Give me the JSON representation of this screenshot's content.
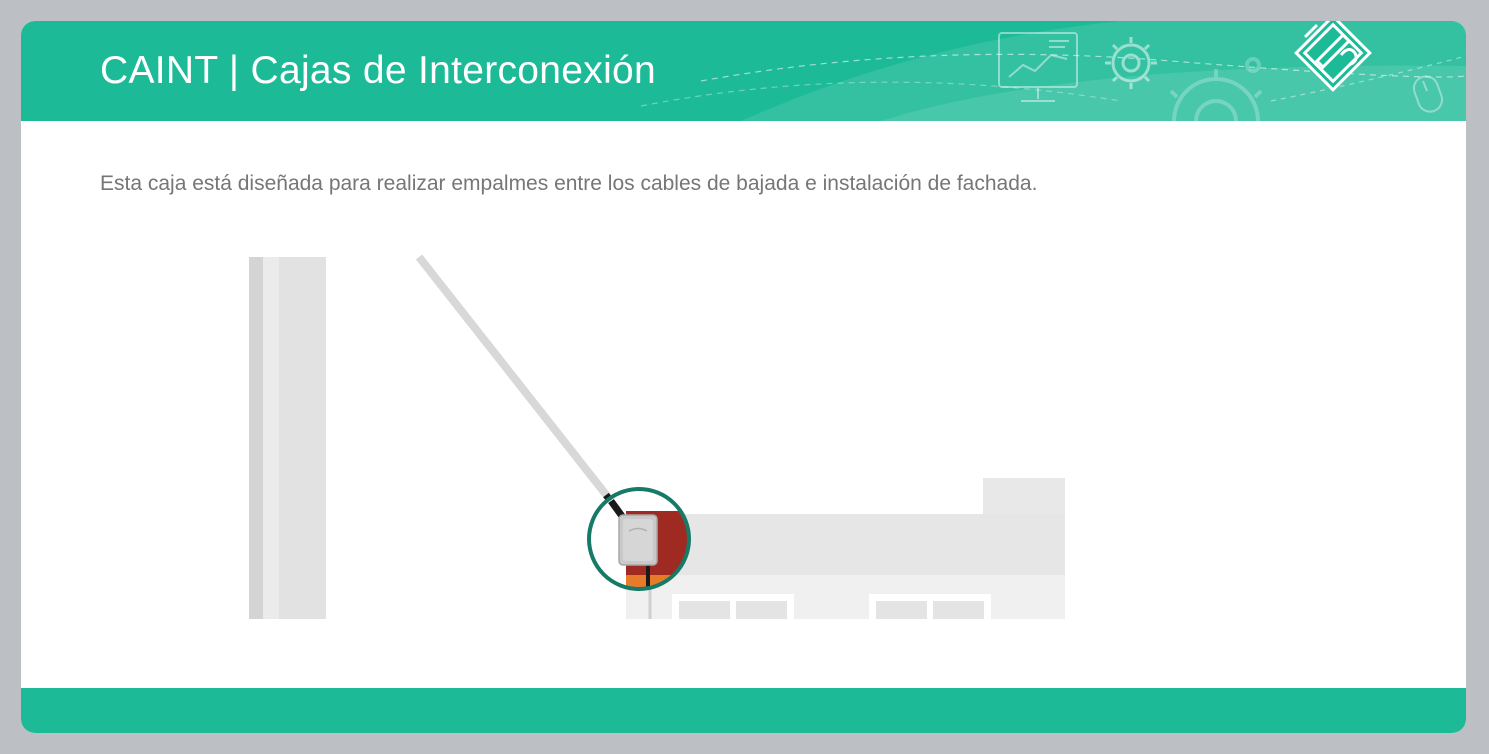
{
  "header": {
    "title": "CAINT | Cajas de Interconexión",
    "icons": [
      "monitor-chart-icon",
      "gear-icon",
      "large-gear-icon",
      "design-tools-icon",
      "mouse-icon"
    ]
  },
  "content": {
    "description": "Esta caja está diseñada para realizar empalmes entre los cables de bajada e instalación de fachada."
  },
  "colors": {
    "brand_green": "#1dba98",
    "circle_outline": "#167a66",
    "building_gray": "#e6e6e6",
    "pole_gray": "#dcdcdc",
    "wall_red": "#9e2a22",
    "accent_orange": "#e87b2a",
    "text_gray": "#767676"
  }
}
